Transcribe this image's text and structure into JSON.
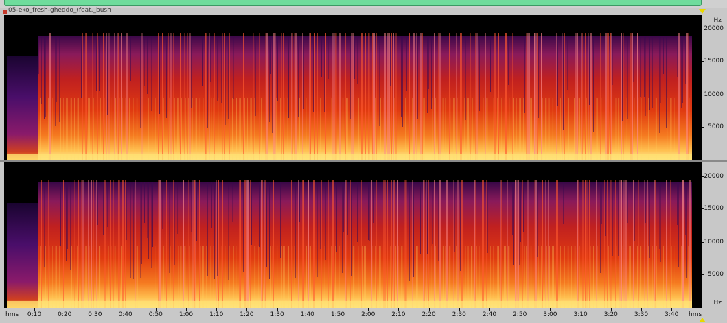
{
  "track": {
    "title": "05-eko_fresh-gheddo_(feat._bush"
  },
  "spectrogram": {
    "channels": [
      "left",
      "right"
    ],
    "colormap": [
      "#000000",
      "#2a0a4a",
      "#7a1a7a",
      "#c0202a",
      "#f04010",
      "#ff9030",
      "#ffe070",
      "#ffffc0"
    ]
  },
  "frequency_axis": {
    "unit_top": "Hz",
    "unit_bottom": "Hz",
    "ticks": [
      "20000",
      "15000",
      "10000",
      "5000"
    ]
  },
  "time_axis": {
    "unit_left": "hms",
    "unit_right": "hms",
    "ticks": [
      "0:10",
      "0:20",
      "0:30",
      "0:40",
      "0:50",
      "1:00",
      "1:10",
      "1:20",
      "1:30",
      "1:40",
      "1:50",
      "2:00",
      "2:10",
      "2:20",
      "2:30",
      "2:40",
      "2:50",
      "3:00",
      "3:10",
      "3:20",
      "3:30",
      "3:40"
    ]
  },
  "colors": {
    "scrollbar": "#6fdc9c",
    "playhead": "#e8d800"
  }
}
